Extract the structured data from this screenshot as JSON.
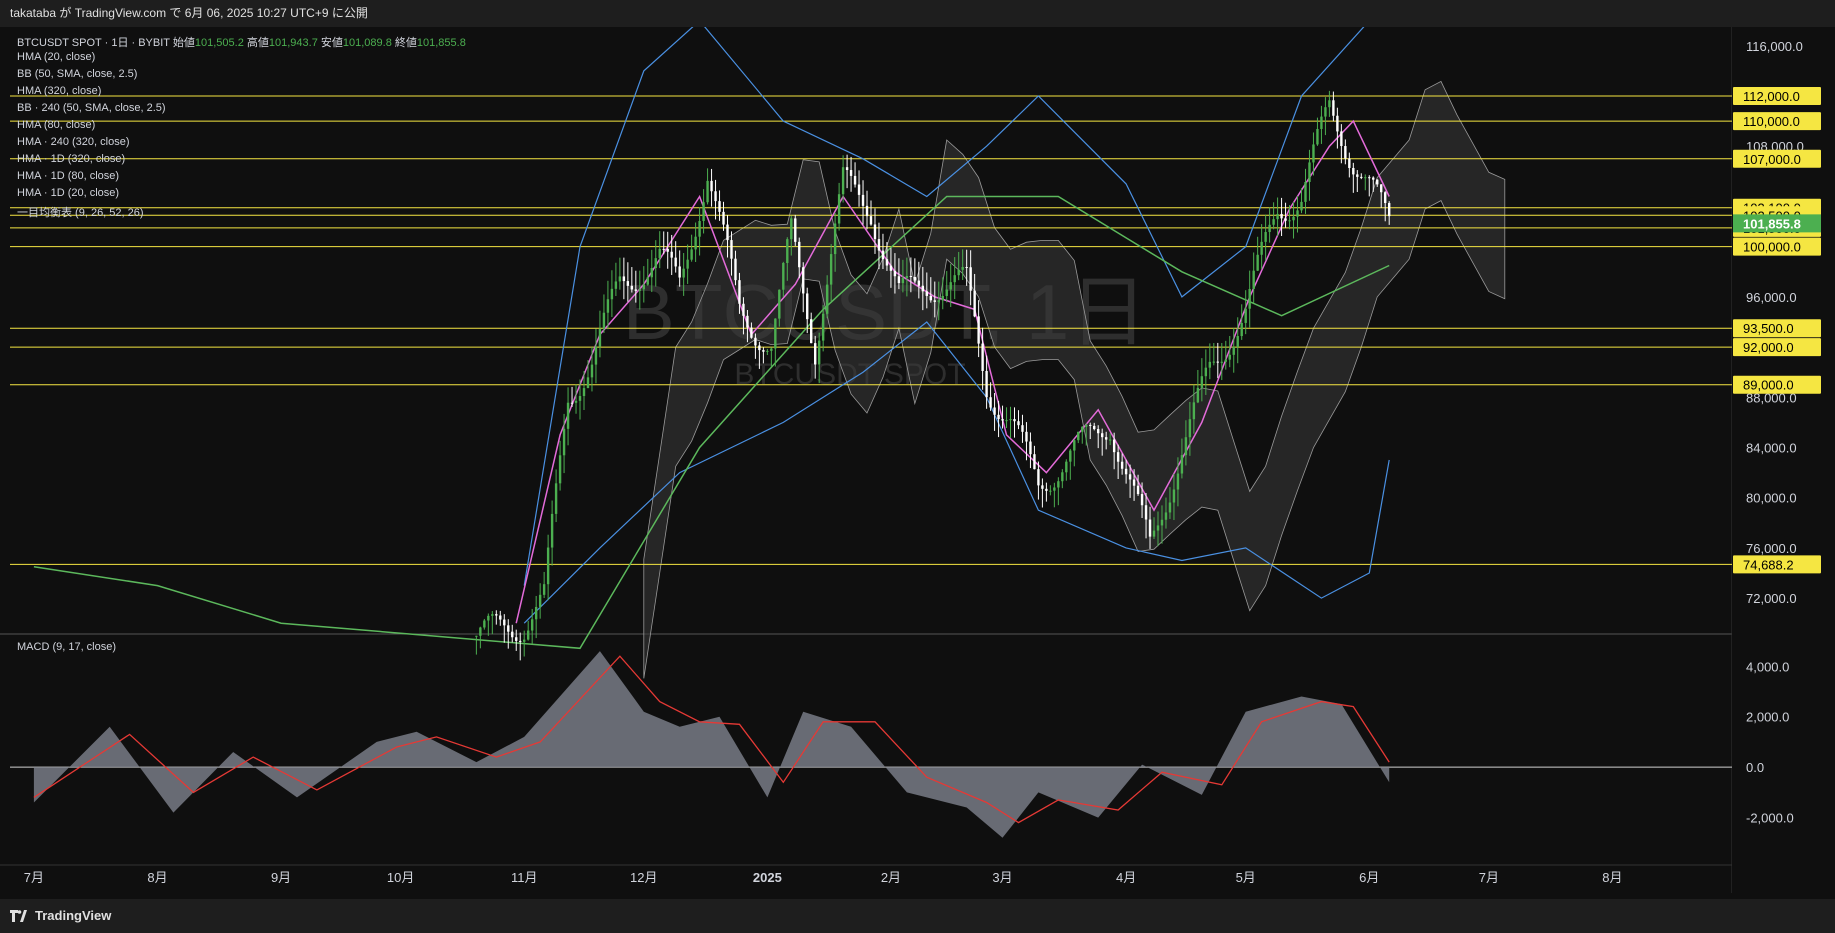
{
  "header": {
    "publish_text": "takataba が TradingView.com で 6月 06, 2025 10:27 UTC+9 に公開"
  },
  "footer": {
    "brand": "TradingView"
  },
  "legend": {
    "symbol": "BTCUSDT SPOT · 1日 · BYBIT",
    "open_label": "始値",
    "open": "101,505.2",
    "high_label": "高値",
    "high": "101,943.7",
    "low_label": "安値",
    "low": "101,089.8",
    "close_label": "終値",
    "close": "101,855.8",
    "indicators": [
      "HMA (20, close)",
      "BB (50, SMA, close, 2.5)",
      "HMA (320, close)",
      "BB · 240 (50, SMA, close, 2.5)",
      "HMA (80, close)",
      "HMA · 240 (320, close)",
      "HMA · 1D (320, close)",
      "HMA · 1D (80, close)",
      "HMA · 1D (20, close)",
      "一目均衡表 (9, 26, 52, 26)"
    ]
  },
  "watermark": {
    "main": "BTCUSDT, 1日",
    "sub": "BTCUSDT SPOT"
  },
  "macd_label": "MACD (9, 17, close)",
  "colors": {
    "bg": "#0f0f0f",
    "level": "#f5e642",
    "bull": "#4caf50",
    "bear": "#ffffff",
    "hma20": "#e36bd9",
    "bb": "#4a90e2",
    "hma320": "#5cb85c",
    "cloud": "#3a3a3a",
    "macd_signal": "#e53935",
    "macd_hist": "#787b86",
    "price_tag": "#4caf50"
  },
  "chart_data": [
    {
      "type": "candlestick",
      "title": "BTCUSDT SPOT · 1日 · BYBIT",
      "y_ticks": [
        116000,
        108000,
        96000,
        88000,
        84000,
        80000,
        76000,
        72000
      ],
      "y_tick_labels": [
        "116,000.0",
        "108,000.0",
        "96,000.0",
        "88,000.0",
        "84,000.0",
        "80,000.0",
        "76,000.0",
        "72,000.0"
      ],
      "ylim": [
        69300,
        117500
      ],
      "x_month_labels": [
        "7月",
        "8月",
        "9月",
        "10月",
        "11月",
        "12月",
        "2025",
        "2月",
        "3月",
        "4月",
        "5月",
        "6月",
        "7月",
        "8月"
      ],
      "x_month_dates": [
        "2024-07-01",
        "2024-08-01",
        "2024-09-01",
        "2024-10-01",
        "2024-11-01",
        "2024-12-01",
        "2025-01-01",
        "2025-02-01",
        "2025-03-01",
        "2025-04-01",
        "2025-05-01",
        "2025-06-01",
        "2025-07-01",
        "2025-08-01"
      ],
      "horizontal_levels": [
        112000,
        110000,
        107000,
        103100,
        102500,
        101500,
        100000,
        93500,
        92000,
        89000,
        74688.2
      ],
      "level_labels": [
        "112,000.0",
        "110,000.0",
        "107,000.0",
        "103,100.0",
        "102,500.0",
        "101,500.0",
        "100,000.0",
        "93,500.0",
        "92,000.0",
        "89,000.0",
        "74,688.2"
      ],
      "last_price": 101855.8,
      "last_price_label": "101,855.8",
      "close_path": {
        "dates": [
          "2024-10-20",
          "2024-11-01",
          "2024-11-06",
          "2024-11-12",
          "2024-11-18",
          "2024-11-25",
          "2024-12-05",
          "2024-12-10",
          "2024-12-17",
          "2024-12-25",
          "2025-01-02",
          "2025-01-07",
          "2025-01-13",
          "2025-01-20",
          "2025-01-27",
          "2025-02-03",
          "2025-02-10",
          "2025-02-20",
          "2025-02-25",
          "2025-03-03",
          "2025-03-10",
          "2025-03-20",
          "2025-03-28",
          "2025-04-07",
          "2025-04-15",
          "2025-04-22",
          "2025-05-01",
          "2025-05-09",
          "2025-05-15",
          "2025-05-22",
          "2025-05-28",
          "2025-06-06"
        ],
        "values": [
          69000,
          70000,
          72000,
          88000,
          91000,
          97000,
          99000,
          97000,
          106000,
          95000,
          92000,
          101000,
          92000,
          105000,
          103000,
          96000,
          97000,
          97000,
          89000,
          86000,
          81000,
          84000,
          86000,
          76000,
          84000,
          90000,
          95000,
          103000,
          104000,
          111000,
          107000,
          101855.8
        ]
      },
      "indicators": {
        "hma20": {
          "dates": [
            "2024-10-30",
            "2024-11-10",
            "2024-11-20",
            "2024-12-01",
            "2024-12-15",
            "2024-12-28",
            "2025-01-08",
            "2025-01-20",
            "2025-02-02",
            "2025-02-12",
            "2025-02-22",
            "2025-03-02",
            "2025-03-12",
            "2025-03-25",
            "2025-04-08",
            "2025-04-20",
            "2025-05-02",
            "2025-05-12",
            "2025-05-22",
            "2025-05-28",
            "2025-06-06"
          ],
          "values": [
            70000,
            85000,
            93000,
            97000,
            104000,
            93000,
            97000,
            104000,
            98000,
            96000,
            95000,
            85000,
            82000,
            87000,
            79000,
            86000,
            96000,
            103000,
            108000,
            110000,
            104000
          ]
        },
        "bb_upper": {
          "dates": [
            "2024-11-01",
            "2024-11-15",
            "2024-12-01",
            "2024-12-15",
            "2025-01-05",
            "2025-01-25",
            "2025-02-10",
            "2025-02-25",
            "2025-03-10",
            "2025-04-01",
            "2025-04-15",
            "2025-05-01",
            "2025-05-15",
            "2025-06-01"
          ],
          "values": [
            73000,
            100000,
            114000,
            118000,
            110000,
            107000,
            104000,
            108000,
            112000,
            105000,
            96000,
            100000,
            112000,
            118000
          ]
        },
        "bb_lower": {
          "dates": [
            "2024-11-01",
            "2024-11-20",
            "2024-12-10",
            "2025-01-05",
            "2025-01-25",
            "2025-02-10",
            "2025-02-25",
            "2025-03-10",
            "2025-04-01",
            "2025-04-15",
            "2025-05-01",
            "2025-05-20",
            "2025-06-01",
            "2025-06-06"
          ],
          "values": [
            70000,
            76000,
            82000,
            86000,
            90000,
            94000,
            88000,
            79000,
            76000,
            75000,
            76000,
            72000,
            74000,
            83000
          ]
        },
        "hma320": {
          "dates": [
            "2024-07-01",
            "2024-08-01",
            "2024-09-01",
            "2024-11-15",
            "2024-12-15",
            "2025-01-15",
            "2025-02-15",
            "2025-03-15",
            "2025-04-15",
            "2025-05-10",
            "2025-06-06"
          ],
          "values": [
            74500,
            73000,
            70000,
            68000,
            84000,
            95000,
            104000,
            104000,
            98000,
            94500,
            98500
          ]
        }
      }
    },
    {
      "type": "area",
      "title": "MACD (9, 17, close)",
      "y_ticks": [
        4000,
        2000,
        0,
        -2000
      ],
      "y_tick_labels": [
        "4,000.0",
        "2,000.0",
        "0.0",
        "-2,000.0"
      ],
      "ylim": [
        -3800,
        5200
      ],
      "macd": {
        "dates": [
          "2024-07-01",
          "2024-07-20",
          "2024-08-05",
          "2024-08-20",
          "2024-09-05",
          "2024-09-25",
          "2024-10-05",
          "2024-10-20",
          "2024-11-01",
          "2024-11-20",
          "2024-12-01",
          "2024-12-10",
          "2024-12-20",
          "2025-01-01",
          "2025-01-10",
          "2025-01-22",
          "2025-02-05",
          "2025-02-20",
          "2025-03-01",
          "2025-03-10",
          "2025-03-25",
          "2025-04-05",
          "2025-04-20",
          "2025-05-01",
          "2025-05-15",
          "2025-05-25",
          "2025-06-06"
        ],
        "values": [
          -1400,
          1600,
          -1800,
          600,
          -1200,
          1000,
          1400,
          200,
          1200,
          4600,
          2200,
          1600,
          2000,
          -1200,
          2200,
          1600,
          -1000,
          -1600,
          -2800,
          -1000,
          -2000,
          100,
          -1100,
          2200,
          2800,
          2500,
          -600
        ]
      },
      "signal": {
        "dates": [
          "2024-07-01",
          "2024-07-25",
          "2024-08-10",
          "2024-08-25",
          "2024-09-10",
          "2024-09-30",
          "2024-10-10",
          "2024-10-25",
          "2024-11-05",
          "2024-11-25",
          "2024-12-05",
          "2024-12-15",
          "2024-12-25",
          "2025-01-05",
          "2025-01-15",
          "2025-01-28",
          "2025-02-10",
          "2025-02-25",
          "2025-03-05",
          "2025-03-15",
          "2025-03-30",
          "2025-04-10",
          "2025-04-25",
          "2025-05-05",
          "2025-05-20",
          "2025-05-28",
          "2025-06-06"
        ],
        "values": [
          -1200,
          1300,
          -1000,
          400,
          -900,
          800,
          1200,
          400,
          1000,
          4400,
          2600,
          1800,
          1700,
          -600,
          1800,
          1800,
          -400,
          -1400,
          -2200,
          -1300,
          -1700,
          -200,
          -700,
          1800,
          2600,
          2400,
          200
        ]
      }
    }
  ]
}
